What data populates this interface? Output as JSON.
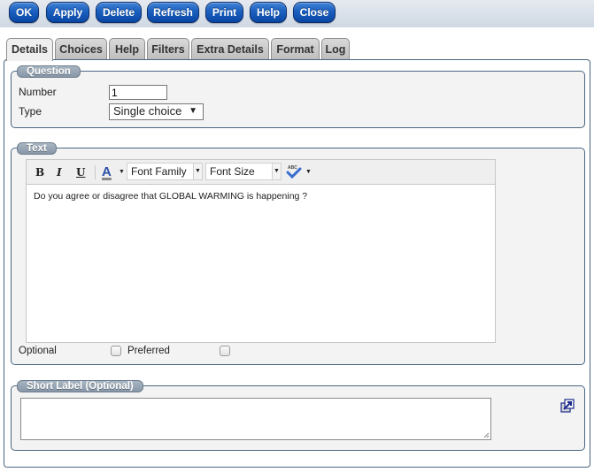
{
  "toolbar": {
    "buttons": [
      {
        "id": "ok",
        "label": "OK"
      },
      {
        "id": "apply",
        "label": "Apply"
      },
      {
        "id": "delete",
        "label": "Delete"
      },
      {
        "id": "refresh",
        "label": "Refresh"
      },
      {
        "id": "print",
        "label": "Print"
      },
      {
        "id": "help",
        "label": "Help"
      },
      {
        "id": "close",
        "label": "Close"
      }
    ]
  },
  "tabs": [
    {
      "label": "Details",
      "active": true
    },
    {
      "label": "Choices",
      "active": false
    },
    {
      "label": "Help",
      "active": false
    },
    {
      "label": "Filters",
      "active": false
    },
    {
      "label": "Extra Details",
      "active": false
    },
    {
      "label": "Format",
      "active": false
    },
    {
      "label": "Log",
      "active": false
    }
  ],
  "question": {
    "legend": "Question",
    "number_label": "Number",
    "number_value": "1",
    "type_label": "Type",
    "type_value": "Single choice",
    "type_arrow": "▼"
  },
  "text_section": {
    "legend": "Text",
    "editor": {
      "bold": "B",
      "italic": "I",
      "underline": "U",
      "font_color_glyph": "A",
      "font_color": "#2b4fa8",
      "font_family_placeholder": "Font Family",
      "font_size_placeholder": "Font Size",
      "spellcheck_label": "ABC",
      "dropdown_arrow": "▼",
      "content": "Do you agree or disagree that GLOBAL WARMING is happening ?"
    },
    "optional_label": "Optional",
    "optional_checked": false,
    "preferred_label": "Preferred",
    "preferred_checked": false
  },
  "short_label": {
    "legend": "Short Label (Optional)",
    "value": ""
  },
  "colors": {
    "button_blue": "#1b5fbf",
    "border_navy": "#4a6580",
    "legend_gray": "#8797a8"
  }
}
